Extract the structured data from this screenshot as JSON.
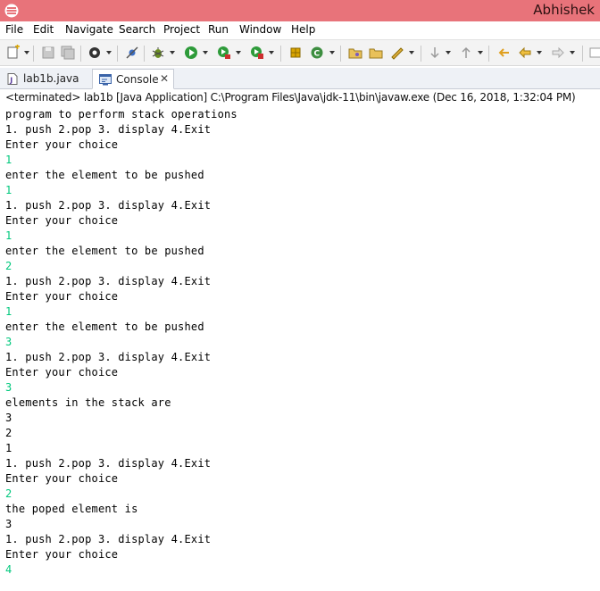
{
  "window": {
    "title": "Abhishek"
  },
  "menu": [
    {
      "label": "File",
      "name": "menu-file"
    },
    {
      "label": "Edit",
      "name": "menu-edit"
    },
    {
      "label": "Navigate",
      "name": "menu-navigate"
    },
    {
      "label": "Search",
      "name": "menu-search"
    },
    {
      "label": "Project",
      "name": "menu-project"
    },
    {
      "label": "Run",
      "name": "menu-run"
    },
    {
      "label": "Window",
      "name": "menu-window"
    },
    {
      "label": "Help",
      "name": "menu-help"
    }
  ],
  "tabs": [
    {
      "label": "lab1b.java",
      "icon": "java-file-icon",
      "active": false
    },
    {
      "label": "Console",
      "icon": "console-icon",
      "active": true,
      "close": "✕"
    }
  ],
  "console": {
    "status": "<terminated> lab1b [Java Application] C:\\Program Files\\Java\\jdk-11\\bin\\javaw.exe (Dec 16, 2018, 1:32:04 PM)",
    "input_color": "#00c87d",
    "lines": [
      {
        "text": "program to perform stack operations",
        "kind": "out"
      },
      {
        "text": "1. push 2.pop 3. display 4.Exit",
        "kind": "out"
      },
      {
        "text": "Enter your choice",
        "kind": "out"
      },
      {
        "text": "1",
        "kind": "in"
      },
      {
        "text": "enter the element to be pushed",
        "kind": "out"
      },
      {
        "text": "1",
        "kind": "in"
      },
      {
        "text": "1. push 2.pop 3. display 4.Exit",
        "kind": "out"
      },
      {
        "text": "Enter your choice",
        "kind": "out"
      },
      {
        "text": "1",
        "kind": "in"
      },
      {
        "text": "enter the element to be pushed",
        "kind": "out"
      },
      {
        "text": "2",
        "kind": "in"
      },
      {
        "text": "1. push 2.pop 3. display 4.Exit",
        "kind": "out"
      },
      {
        "text": "Enter your choice",
        "kind": "out"
      },
      {
        "text": "1",
        "kind": "in"
      },
      {
        "text": "enter the element to be pushed",
        "kind": "out"
      },
      {
        "text": "3",
        "kind": "in"
      },
      {
        "text": "1. push 2.pop 3. display 4.Exit",
        "kind": "out"
      },
      {
        "text": "Enter your choice",
        "kind": "out"
      },
      {
        "text": "3",
        "kind": "in"
      },
      {
        "text": "elements in the stack are",
        "kind": "out"
      },
      {
        "text": "3",
        "kind": "out"
      },
      {
        "text": "2",
        "kind": "out"
      },
      {
        "text": "1",
        "kind": "out"
      },
      {
        "text": "1. push 2.pop 3. display 4.Exit",
        "kind": "out"
      },
      {
        "text": "Enter your choice",
        "kind": "out"
      },
      {
        "text": "2",
        "kind": "in"
      },
      {
        "text": "the poped element is",
        "kind": "out"
      },
      {
        "text": "3",
        "kind": "out"
      },
      {
        "text": "1. push 2.pop 3. display 4.Exit",
        "kind": "out"
      },
      {
        "text": "Enter your choice",
        "kind": "out"
      },
      {
        "text": "4",
        "kind": "in"
      }
    ]
  }
}
